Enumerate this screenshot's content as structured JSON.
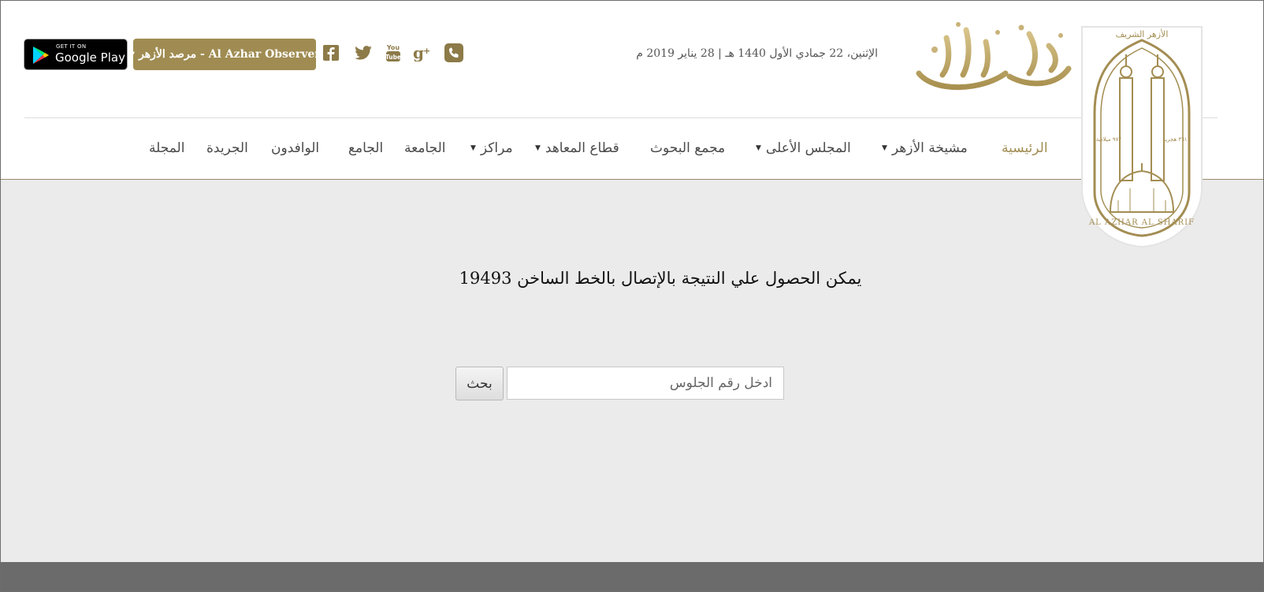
{
  "header": {
    "google_play": {
      "small": "GET IT ON",
      "big": "Google Play"
    },
    "observer_label": "مرصد الأزهر - Al Azhar Observer",
    "social_icons": [
      "facebook-icon",
      "twitter-icon",
      "youtube-icon",
      "google-plus-icon",
      "phone-icon"
    ],
    "date": "الإثنين، 22 جمادي الأول 1440 هـ | 28 يناير 2019 م",
    "brand_title": "بوابة الأزهر",
    "emblem_text": "AL AZHAR AL SHARIF",
    "emblem_arabic": "الأزهر الشريف",
    "emblem_year_right": "٩٧٢ ميلادية",
    "emblem_year_left": "٣٦١ هجرية"
  },
  "nav": {
    "items": [
      {
        "label": "الرئيسية",
        "active": true,
        "dropdown": false
      },
      {
        "label": "مشيخة الأزهر",
        "dropdown": true
      },
      {
        "label": "المجلس الأعلى",
        "dropdown": true
      },
      {
        "label": "مجمع البحوث",
        "dropdown": false
      },
      {
        "label": "قطاع المعاهد",
        "dropdown": true
      },
      {
        "label": "مراكز",
        "dropdown": true
      },
      {
        "label": "الجامعة",
        "dropdown": false
      },
      {
        "label": "الجامع",
        "dropdown": false
      },
      {
        "label": "الوافدون",
        "dropdown": false
      },
      {
        "label": "الجريدة",
        "dropdown": false
      },
      {
        "label": "المجلة",
        "dropdown": false
      }
    ]
  },
  "main": {
    "info_text": "يمكن الحصول علي النتيجة بالإتصال بالخط الساخن 19493",
    "search": {
      "placeholder": "ادخل رقم الجلوس",
      "value": "",
      "button_label": "بحث"
    }
  },
  "colors": {
    "accent": "#a08c52",
    "background": "#ebebeb",
    "footer": "#6b6b6b"
  }
}
